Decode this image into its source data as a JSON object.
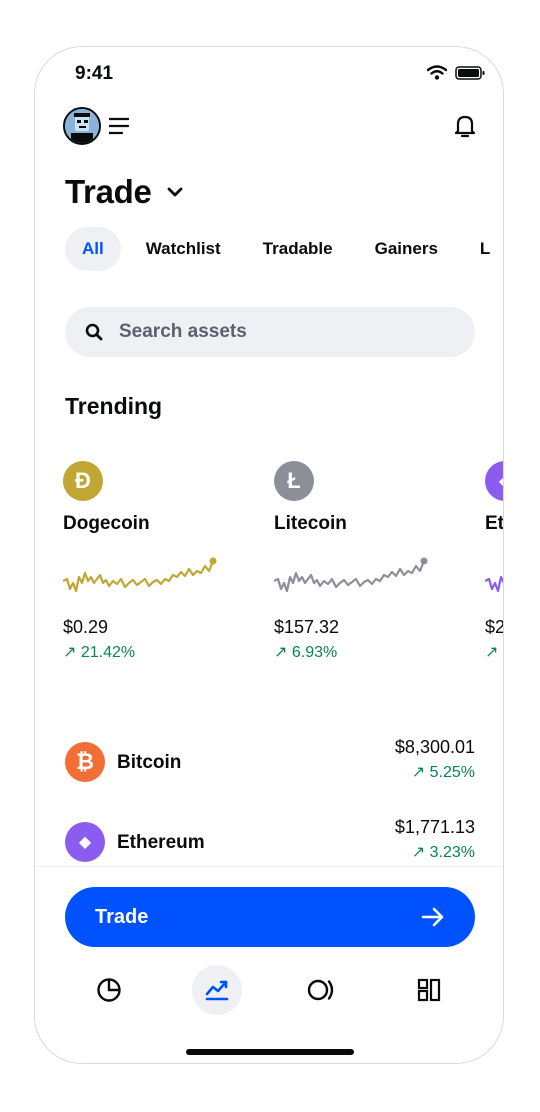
{
  "status_bar": {
    "time": "9:41"
  },
  "header": {
    "title": "Trade"
  },
  "tabs": [
    {
      "label": "All",
      "active": true
    },
    {
      "label": "Watchlist",
      "active": false
    },
    {
      "label": "Tradable",
      "active": false
    },
    {
      "label": "Gainers",
      "active": false
    },
    {
      "label": "L",
      "active": false
    }
  ],
  "search": {
    "placeholder": "Search assets"
  },
  "trending": {
    "title": "Trending",
    "items": [
      {
        "name": "Dogecoin",
        "price": "$0.29",
        "change": "↗ 21.42%",
        "icon": "dogecoin-icon",
        "icon_glyph": "Ð",
        "color": "#c2a633",
        "chart_color": "#c2a633"
      },
      {
        "name": "Litecoin",
        "price": "$157.32",
        "change": "↗ 6.93%",
        "icon": "litecoin-icon",
        "icon_glyph": "Ł",
        "color": "#8a8f98",
        "chart_color": "#8a8f98"
      },
      {
        "name": "Et",
        "price": "$2",
        "change": "↗",
        "icon": "ethereum-icon",
        "icon_glyph": "◆",
        "color": "#8c5cf0",
        "chart_color": "#8c5cf0"
      }
    ]
  },
  "assets": [
    {
      "name": "Bitcoin",
      "price": "$8,300.01",
      "change": "↗ 5.25%",
      "icon": "bitcoin-icon",
      "icon_glyph": "₿",
      "color": "#f26e34"
    },
    {
      "name": "Ethereum",
      "price": "$1,771.13",
      "change": "↗ 3.23%",
      "icon": "ethereum-icon",
      "icon_glyph": "◆",
      "color": "#8c5cf0"
    }
  ],
  "trade_button": {
    "label": "Trade"
  },
  "bottom_nav": [
    {
      "icon": "portfolio-pie-icon",
      "active": false
    },
    {
      "icon": "trade-chart-icon",
      "active": true
    },
    {
      "icon": "earn-icon",
      "active": false
    },
    {
      "icon": "apps-grid-icon",
      "active": false
    }
  ],
  "colors": {
    "accent": "#0052ff",
    "positive": "#098551",
    "surface": "#eef0f3"
  }
}
